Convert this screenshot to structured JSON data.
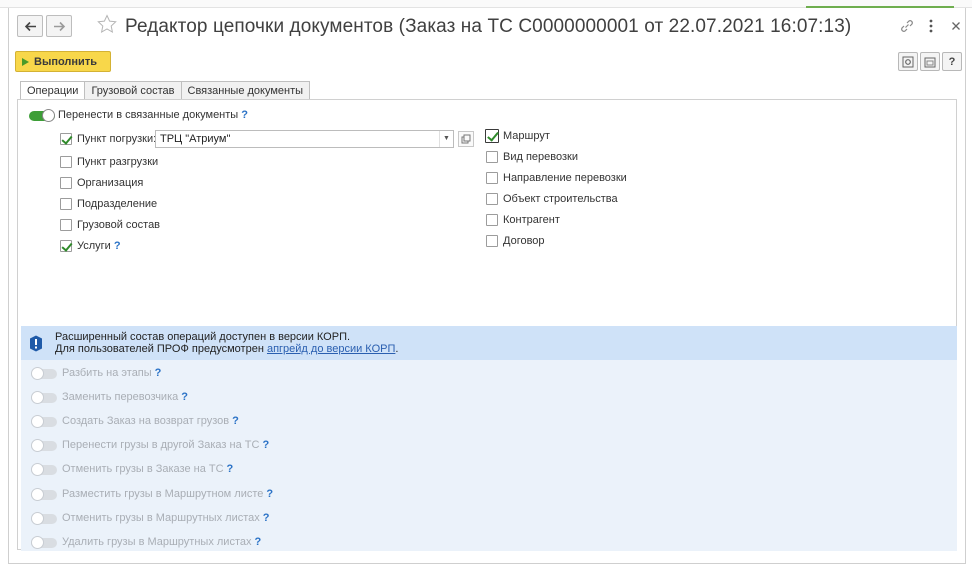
{
  "window": {
    "title": "Редактор цепочки документов (Заказ на ТС С0000000001 от 22.07.2021 16:07:13)"
  },
  "toolbar": {
    "run_label": "Выполнить",
    "help_label": "?"
  },
  "tabs": [
    {
      "label": "Операции",
      "active": true
    },
    {
      "label": "Грузовой состав",
      "active": false
    },
    {
      "label": "Связанные документы",
      "active": false
    }
  ],
  "transfer": {
    "label": "Перенести в связанные документы",
    "help": "?",
    "enabled": true
  },
  "left_options": [
    {
      "label": "Пункт погрузки:",
      "checked": true
    },
    {
      "label": "Пункт разгрузки",
      "checked": false
    },
    {
      "label": "Организация",
      "checked": false
    },
    {
      "label": "Подразделение",
      "checked": false
    },
    {
      "label": "Грузовой состав",
      "checked": false
    },
    {
      "label": "Услуги",
      "checked": true,
      "help": "?"
    }
  ],
  "loading_point": {
    "value": "ТРЦ \"Атриум\""
  },
  "right_options": [
    {
      "label": "Маршрут",
      "checked": true
    },
    {
      "label": "Вид перевозки",
      "checked": false
    },
    {
      "label": "Направление перевозки",
      "checked": false
    },
    {
      "label": "Объект строительства",
      "checked": false
    },
    {
      "label": "Контрагент",
      "checked": false
    },
    {
      "label": "Договор",
      "checked": false
    }
  ],
  "info": {
    "line1": "Расширенный состав операций доступен в версии КОРП.",
    "line2_prefix": "Для пользователей ПРОФ предусмотрен ",
    "line2_link": "апгрейд до версии КОРП",
    "line2_suffix": "."
  },
  "corp_operations": [
    {
      "label": "Разбить на этапы",
      "help": "?"
    },
    {
      "label": "Заменить перевозчика",
      "help": "?"
    },
    {
      "label": "Создать Заказ на возврат грузов",
      "help": "?"
    },
    {
      "label": "Перенести грузы в другой Заказ на ТС",
      "help": "?"
    },
    {
      "label": "Отменить грузы в Заказе на ТС",
      "help": "?"
    },
    {
      "label": "Разместить грузы в Маршрутном листе",
      "help": "?"
    },
    {
      "label": "Отменить грузы в Маршрутных листах",
      "help": "?"
    },
    {
      "label": "Удалить грузы в Маршрутных листах",
      "help": "?"
    }
  ],
  "colors": {
    "accent_green": "#3d9e37",
    "run_button": "#f8d74a",
    "info_banner": "#cfe2f8",
    "help_blue": "#2a72c6"
  }
}
